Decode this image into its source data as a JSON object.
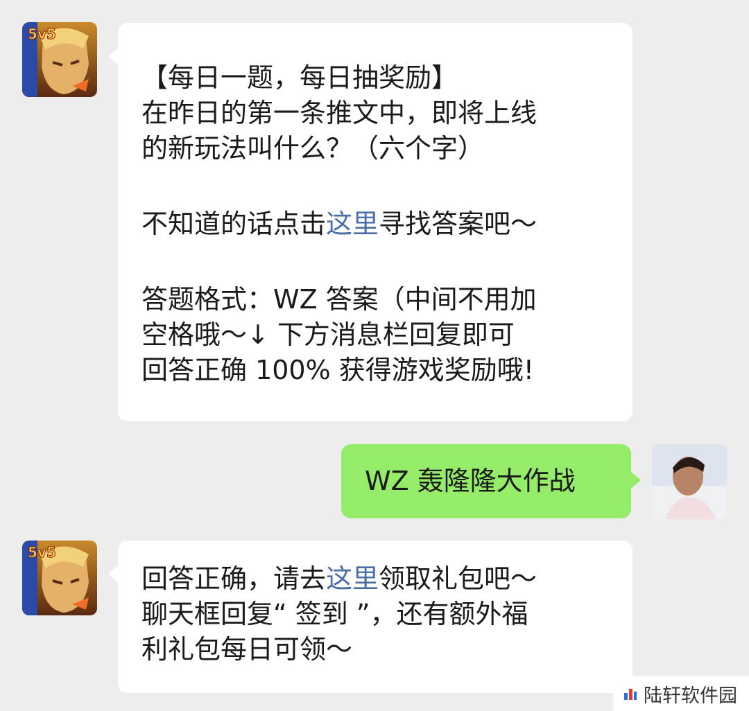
{
  "messages": [
    {
      "sender": "game-account",
      "lines_1": [
        "【每日一题，每日抽奖励】",
        "在昨日的第一条推文中，即将上线",
        "的新玩法叫什么？（六个字）"
      ],
      "line_link_pre": "不知道的话点击",
      "line_link": "这里",
      "line_link_post": "寻找答案吧～",
      "lines_3": [
        "答题格式：WZ 答案（中间不用加",
        "空格哦～↓ 下方消息栏回复即可",
        "回答正确 100% 获得游戏奖励哦!"
      ]
    },
    {
      "sender": "user",
      "text": "WZ 轰隆隆大作战"
    },
    {
      "sender": "game-account",
      "line1_pre": "回答正确，请去",
      "line1_link": "这里",
      "line1_post": "领取礼包吧～",
      "line2": "聊天框回复“ 签到 ”，还有额外福",
      "line3": "利礼包每日可领～"
    }
  ],
  "avatar_badge": "5v5",
  "watermark": "陆轩软件园",
  "colors": {
    "background": "#ededed",
    "incoming_bubble": "#ffffff",
    "outgoing_bubble": "#95ec69",
    "link": "#4a6ea8"
  }
}
